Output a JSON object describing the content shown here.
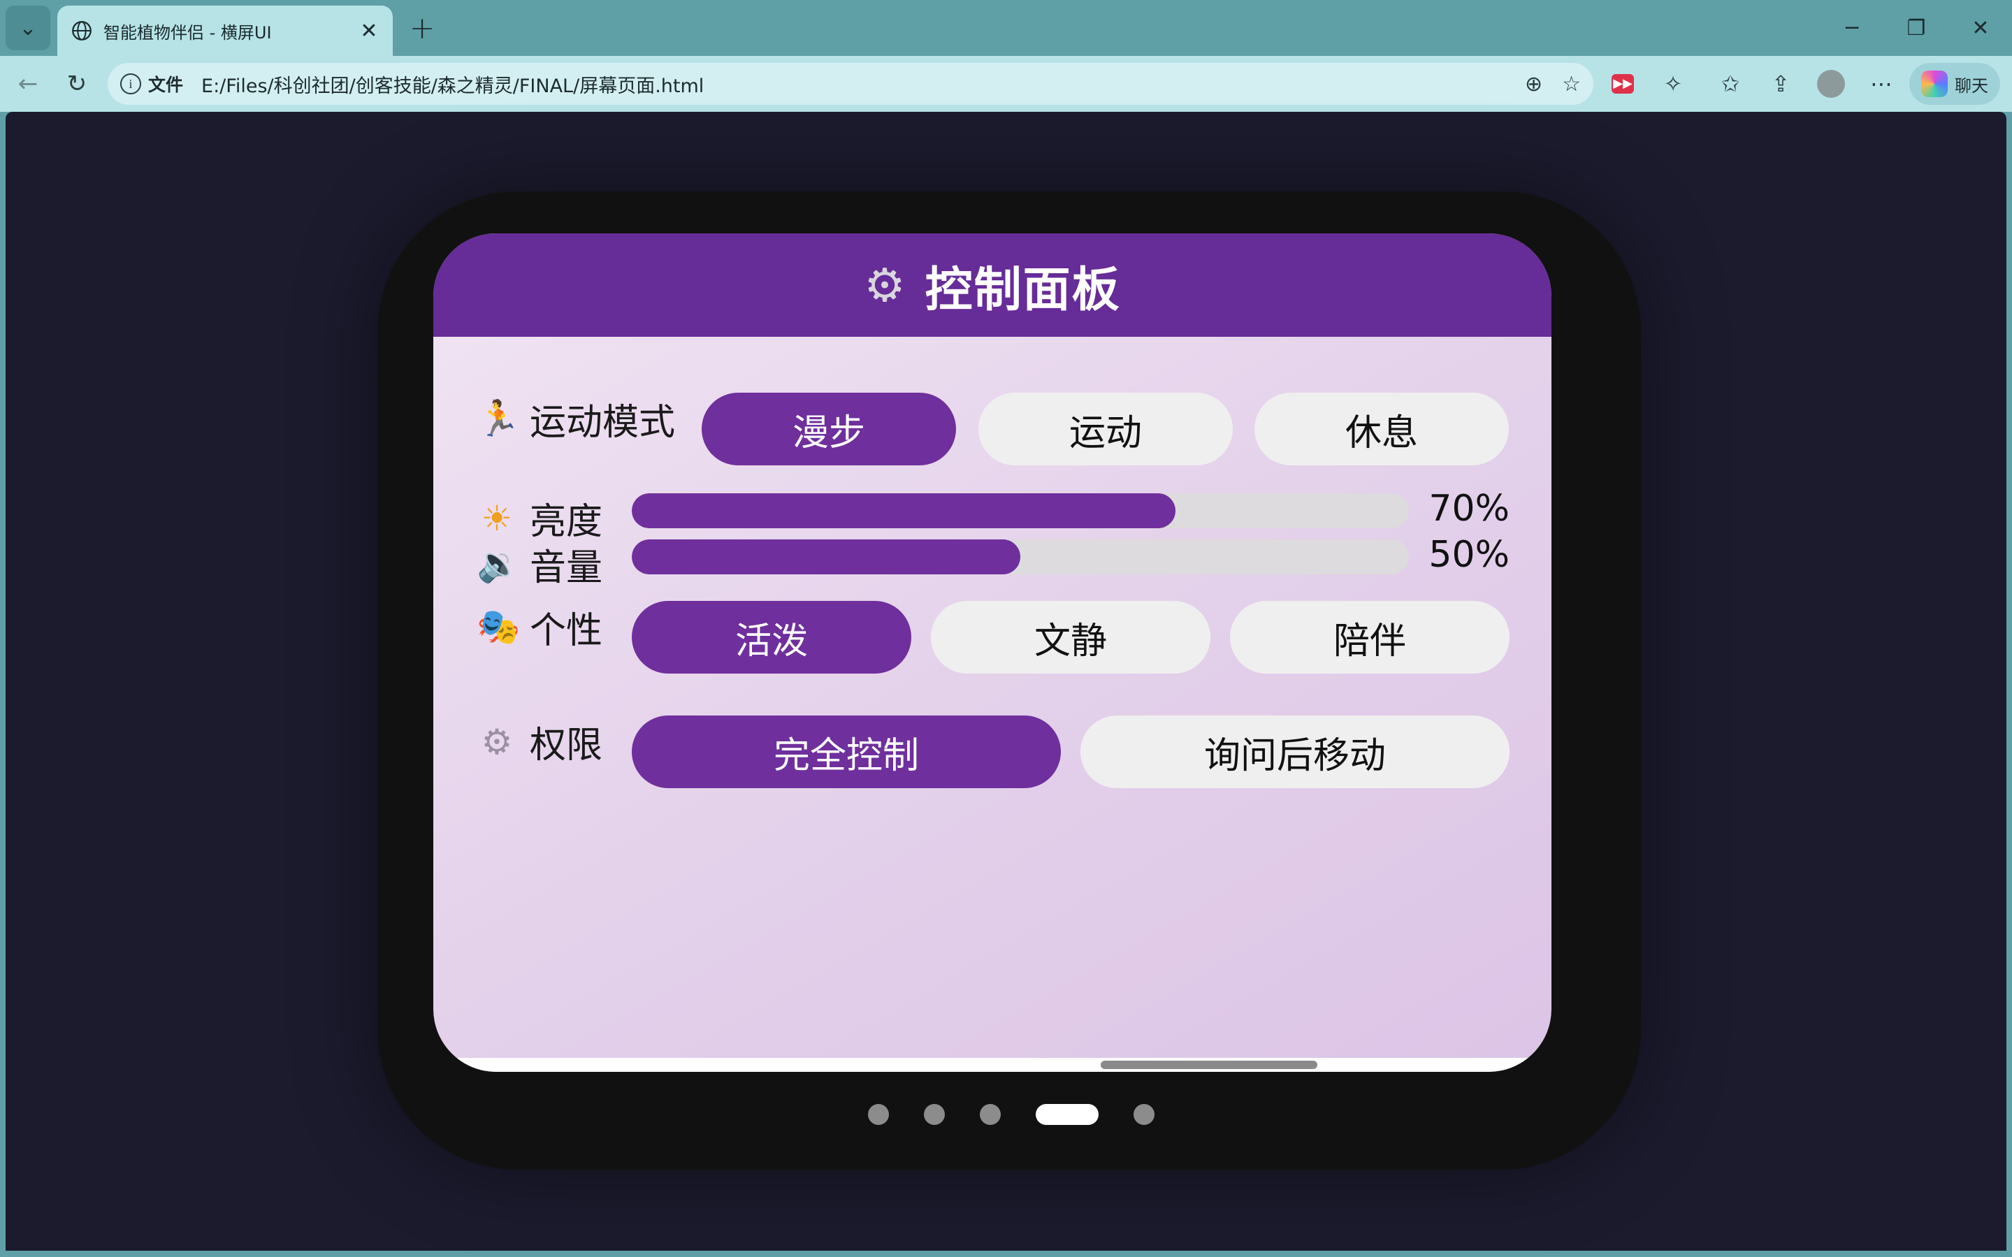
{
  "browser": {
    "tab_title": "智能植物伴侣 - 横屏UI",
    "tab_close": "✕",
    "new_tab": "+",
    "minimize": "─",
    "restore": "❐",
    "close": "✕",
    "address_prefix": "文件",
    "address_url": "E:/Files/科创社团/创客技能/森之精灵/FINAL/屏幕页面.html",
    "copilot_label": "聊天",
    "icons": [
      "tab-list-icon",
      "globe-icon",
      "back-icon",
      "reload-icon",
      "info-icon",
      "zoom-icon",
      "star-icon",
      "extension-red-icon",
      "puzzle-icon",
      "favorites-icon",
      "share-icon",
      "profile-icon",
      "more-icon",
      "copilot-icon"
    ]
  },
  "panel": {
    "header_icon": "gear-icon",
    "title": "控制面板",
    "motion": {
      "icon": "running-icon",
      "label": "运动模式",
      "options": [
        "漫步",
        "运动",
        "休息"
      ],
      "selected": "漫步"
    },
    "brightness": {
      "icon": "sun-icon",
      "label": "亮度",
      "value": 70,
      "value_text": "70%"
    },
    "volume": {
      "icon": "speaker-icon",
      "label": "音量",
      "value": 50,
      "value_text": "50%"
    },
    "personality": {
      "icon": "theater-masks-icon",
      "label": "个性",
      "options": [
        "活泼",
        "文静",
        "陪伴"
      ],
      "selected": "活泼"
    },
    "permission": {
      "icon": "gear-icon",
      "label": "权限",
      "options": [
        "完全控制",
        "询问后移动"
      ],
      "selected": "完全控制"
    }
  },
  "pager": {
    "page_count": 5,
    "current_page": 4
  },
  "colors": {
    "accent": "#6f2f9c",
    "header": "#662c97",
    "tabstrip": "#5f9fa6",
    "toolbar": "#b7e3e7",
    "page_bg": "#1c1b2e"
  }
}
